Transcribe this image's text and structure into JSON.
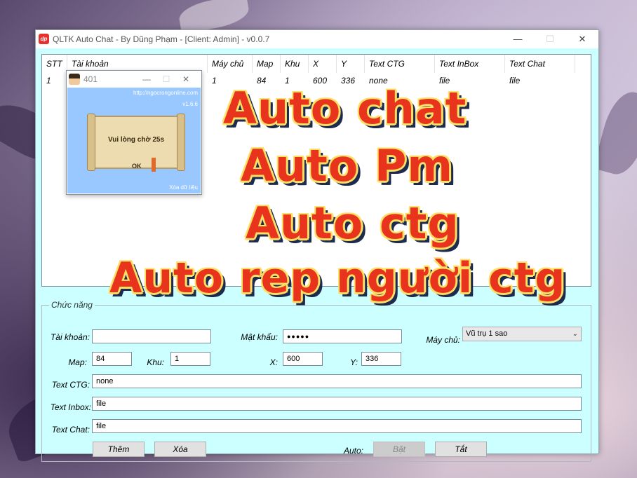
{
  "window": {
    "icon_text": "dp",
    "title": "QLTK Auto Chat - By Dũng Phạm - [Client: Admin] - v0.0.7",
    "minimize_glyph": "—",
    "maximize_glyph": "☐",
    "close_glyph": "✕"
  },
  "table": {
    "columns": [
      "STT",
      "Tài khoản",
      "Máy chủ",
      "Map",
      "Khu",
      "X",
      "Y",
      "Text CTG",
      "Text InBox",
      "Text Chat"
    ],
    "rows": [
      [
        "1",
        "",
        "1",
        "84",
        "1",
        "600",
        "336",
        "none",
        "file",
        "file"
      ]
    ]
  },
  "popup": {
    "title": "401",
    "url": "http://ngocrongonline.com",
    "version": "v1.6.6",
    "message": "Vui lòng chờ 25s",
    "ok_label": "OK",
    "delete_label": "Xóa dữ liệu"
  },
  "form": {
    "group_label": "Chức năng",
    "account_label": "Tài khoản:",
    "account_value": "",
    "password_label": "Mật khẩu:",
    "password_value": "●●●●●",
    "server_label": "Máy chủ:",
    "server_value": "Vũ trụ 1 sao",
    "map_label": "Map:",
    "map_value": "84",
    "khu_label": "Khu:",
    "khu_value": "1",
    "x_label": "X:",
    "x_value": "600",
    "y_label": "Y:",
    "y_value": "336",
    "text_ctg_label": "Text CTG:",
    "text_ctg_value": "none",
    "text_inbox_label": "Text Inbox:",
    "text_inbox_value": "file",
    "text_chat_label": "Text Chat:",
    "text_chat_value": "file",
    "add_button": "Thêm",
    "delete_button": "Xóa",
    "auto_label": "Auto:",
    "on_button": "Bật",
    "off_button": "Tắt"
  },
  "overlay": {
    "line1": "Auto chat",
    "line2": "Auto Pm",
    "line3": "Auto ctg",
    "line4": "Auto rep người ctg"
  },
  "colors": {
    "client_bg": "#ccffff",
    "overlay_text": "#e8341c",
    "overlay_outline": "#ffe066",
    "overlay_shadow": "#1d2b4f",
    "popup_bg": "#99c7ff"
  }
}
